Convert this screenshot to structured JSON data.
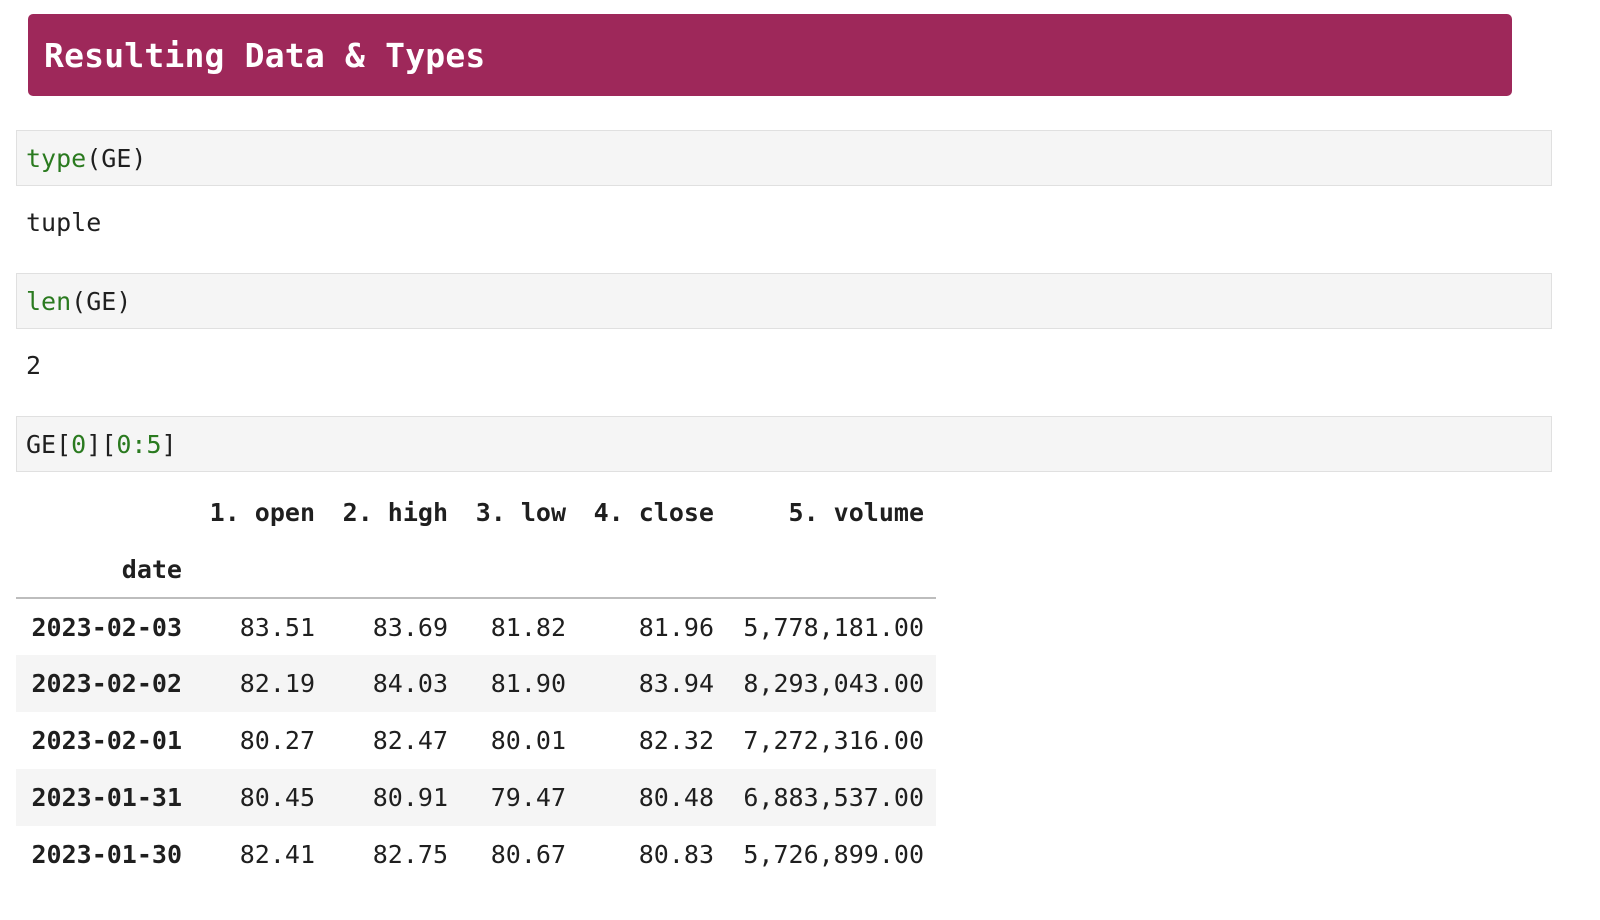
{
  "banner": {
    "title": "Resulting Data & Types"
  },
  "cells": [
    {
      "input": {
        "func": "type",
        "rest": "(GE)"
      },
      "output": "tuple"
    },
    {
      "input": {
        "func": "len",
        "rest": "(GE)"
      },
      "output": "2"
    },
    {
      "input": {
        "t1": "GE[",
        "t2": "0",
        "t3": "][",
        "t4": "0",
        "t5": ":",
        "t6": "5",
        "t7": "]"
      }
    }
  ],
  "table": {
    "columns": [
      "1. open",
      "2. high",
      "3. low",
      "4. close",
      "5. volume"
    ],
    "index_name": "date",
    "rows": [
      {
        "date": "2023-02-03",
        "values": [
          "83.51",
          "83.69",
          "81.82",
          "81.96",
          "5,778,181.00"
        ]
      },
      {
        "date": "2023-02-02",
        "values": [
          "82.19",
          "84.03",
          "81.90",
          "83.94",
          "8,293,043.00"
        ]
      },
      {
        "date": "2023-02-01",
        "values": [
          "80.27",
          "82.47",
          "80.01",
          "82.32",
          "7,272,316.00"
        ]
      },
      {
        "date": "2023-01-31",
        "values": [
          "80.45",
          "80.91",
          "79.47",
          "80.48",
          "6,883,537.00"
        ]
      },
      {
        "date": "2023-01-30",
        "values": [
          "82.41",
          "82.75",
          "80.67",
          "80.83",
          "5,726,899.00"
        ]
      }
    ]
  },
  "colors": {
    "banner_bg": "#9e285a",
    "code_green": "#2a7a1f",
    "cell_bg": "#f5f5f5"
  }
}
